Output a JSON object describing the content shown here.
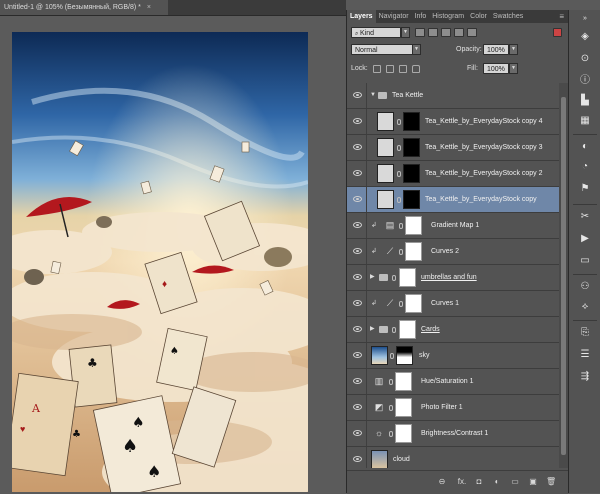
{
  "document": {
    "tab_title": "Untitled-1 @ 105% (Безымянный, RGB/8) *",
    "close_glyph": "×"
  },
  "panel_tabs": [
    "Layers",
    "Navigator",
    "Info",
    "Histogram",
    "Color",
    "Swatches"
  ],
  "panel_menu_glyph": "≡",
  "filter": {
    "kind_label": "Kind"
  },
  "blend": {
    "mode": "Normal",
    "opacity_label": "Opacity:",
    "opacity_value": "100%",
    "lock_label": "Lock:",
    "fill_label": "Fill:",
    "fill_value": "100%"
  },
  "layers": [
    {
      "name": "Tea Kettle",
      "type": "group-open"
    },
    {
      "name": "Tea_Kettle_by_EverydayStock copy 4",
      "type": "smart-mask",
      "indent": true
    },
    {
      "name": "Tea_Kettle_by_EverydayStock copy 3",
      "type": "smart-mask",
      "indent": true
    },
    {
      "name": "Tea_Kettle_by_EverydayStock copy 2",
      "type": "smart-mask",
      "indent": true
    },
    {
      "name": "Tea_Kettle_by_EverydayStock copy",
      "type": "smart-mask",
      "indent": true,
      "selected": true
    },
    {
      "name": "Gradient Map 1",
      "type": "adjustment",
      "clipped": true,
      "icon": "gradient-map-icon"
    },
    {
      "name": "Curves 2",
      "type": "adjustment",
      "clipped": true,
      "icon": "curves-icon"
    },
    {
      "name": "umbrellas and fun",
      "type": "group-closed"
    },
    {
      "name": "Curves 1",
      "type": "adjustment",
      "clipped": true,
      "icon": "curves-icon"
    },
    {
      "name": "Cards",
      "type": "group-closed"
    },
    {
      "name": "sky",
      "type": "image-mask"
    },
    {
      "name": "Hue/Saturation 1",
      "type": "adjustment",
      "icon": "hue-saturation-icon"
    },
    {
      "name": "Photo Filter 1",
      "type": "adjustment",
      "icon": "photo-filter-icon"
    },
    {
      "name": "Brightness/Contrast 1",
      "type": "adjustment",
      "icon": "brightness-contrast-icon"
    },
    {
      "name": "cloud",
      "type": "image"
    }
  ],
  "bottom_icons": [
    "link-icon",
    "fx-icon",
    "add-mask-icon",
    "adjustment-icon",
    "new-group-icon",
    "new-layer-icon",
    "trash-icon"
  ],
  "bottom_glyphs": [
    "⊖",
    "fx.",
    "◘",
    "◐",
    "▭",
    "▣",
    "🗑"
  ],
  "colors": {
    "panel_bg": "#535353",
    "selected_row": "#6f87a8",
    "canvas_bg": "#5b5b5b"
  }
}
